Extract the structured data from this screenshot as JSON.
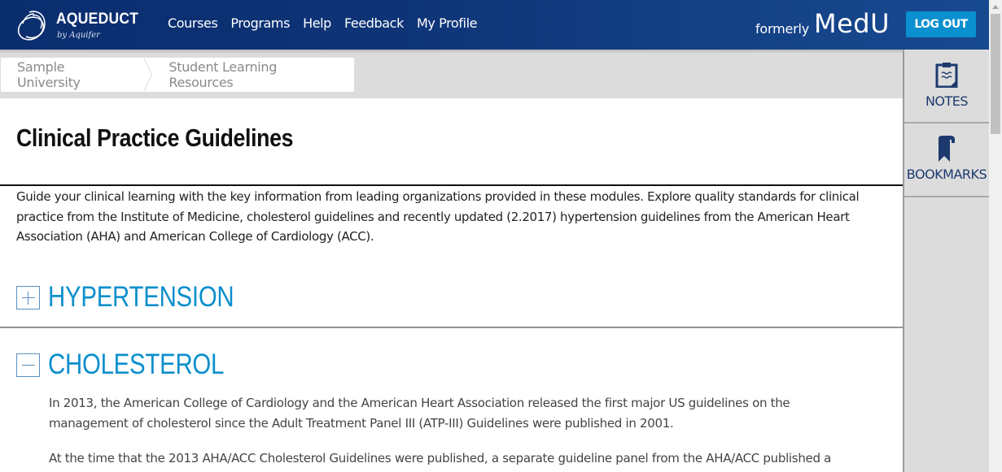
{
  "header": {
    "logo_title": "AQUEDUCT",
    "logo_subtitle": "by Aquifer",
    "nav": [
      "Courses",
      "Programs",
      "Help",
      "Feedback",
      "My Profile"
    ],
    "formerly": "formerly",
    "brand_former": "MedU",
    "logout_label": "LOG OUT"
  },
  "breadcrumb": [
    "Sample University",
    "Student Learning Resources"
  ],
  "page": {
    "title": "Clinical Practice Guidelines",
    "intro": "Guide your clinical learning with the key information from leading organizations provided in these modules. Explore quality standards for clinical practice from the Institute of Medicine, cholesterol guidelines and recently updated (2.2017) hypertension guidelines from the American Heart Association (AHA) and American College of Cardiology (ACC)."
  },
  "sections": [
    {
      "title": "HYPERTENSION",
      "expanded": false,
      "toggle_icon": "plus-icon"
    },
    {
      "title": "CHOLESTEROL",
      "expanded": true,
      "toggle_icon": "minus-icon",
      "paragraphs": [
        "In 2013, the American College of Cardiology and the American Heart Association released the first major US guidelines on the management of cholesterol since the Adult Treatment Panel III (ATP-III) Guidelines were published in 2001.",
        "At the time that the 2013 AHA/ACC Cholesterol Guidelines were published, a separate guideline panel from the AHA/ACC published a"
      ]
    }
  ],
  "sidebar": [
    {
      "label": "NOTES",
      "icon": "clipboard-notes-icon"
    },
    {
      "label": "BOOKMARKS",
      "icon": "bookmark-icon"
    }
  ],
  "colors": {
    "header_bg": "#0e3477",
    "accent": "#0b8fcc",
    "logout_bg": "#0a8fcf",
    "sidebar_icon": "#1c3a6e"
  }
}
